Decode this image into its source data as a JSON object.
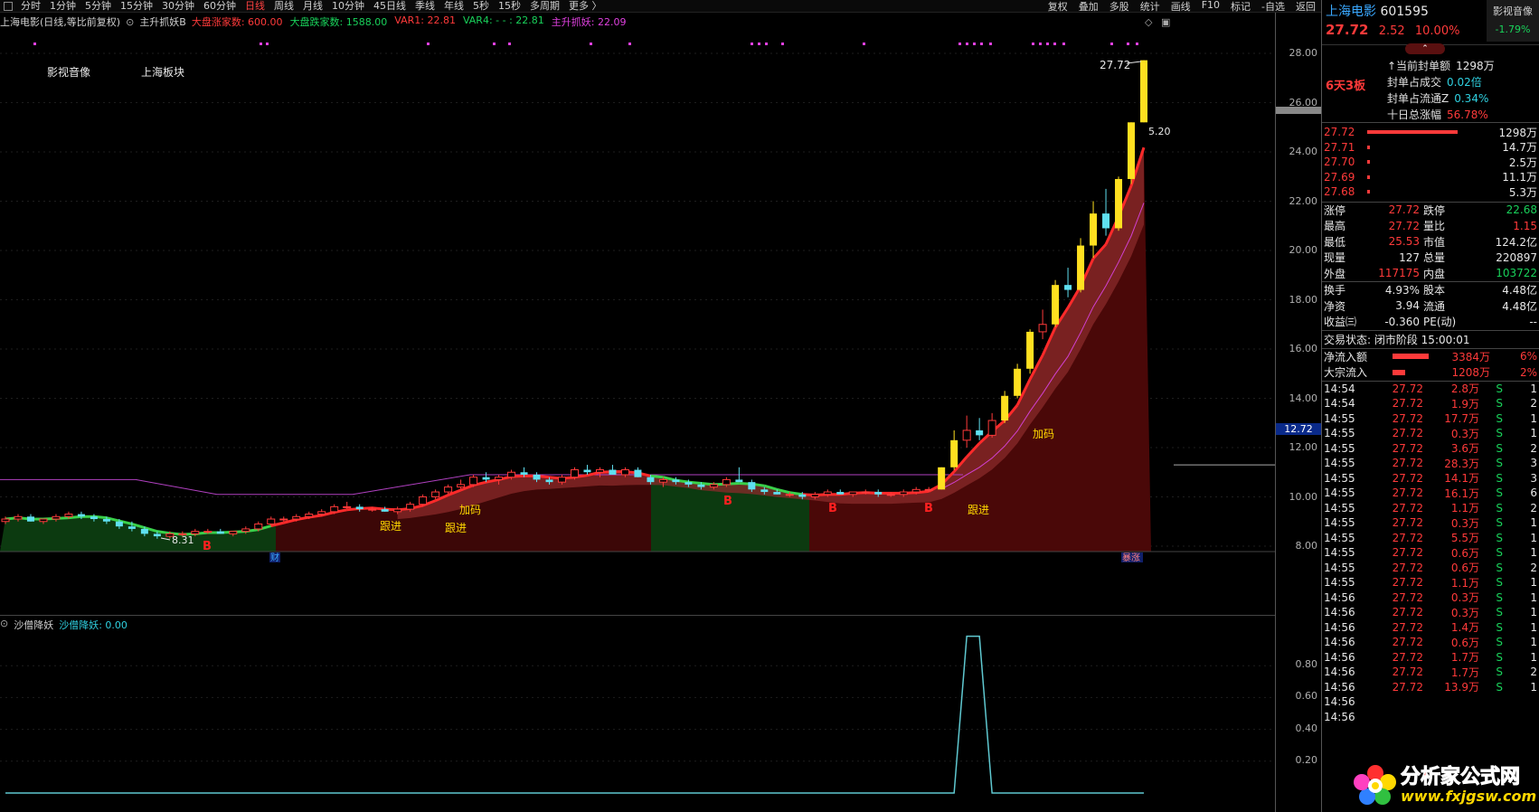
{
  "topbar": {
    "timeframes": [
      "分时",
      "1分钟",
      "5分钟",
      "15分钟",
      "30分钟",
      "60分钟",
      "日线",
      "周线",
      "月线",
      "10分钟",
      "45日线",
      "季线",
      "年线",
      "5秒",
      "15秒",
      "多周期",
      "更多 〉"
    ],
    "active_index": 6,
    "right_buttons": [
      "复权",
      "叠加",
      "多股",
      "统计",
      "画线",
      "F10",
      "标记",
      "-自选",
      "返回"
    ]
  },
  "infobar": {
    "title": "上海电影(日线,等比前复权)",
    "indicator_name": "主升抓妖B",
    "items": [
      {
        "text": "大盘涨家数: 600.00",
        "color": "#ff3a3a"
      },
      {
        "text": "大盘跌家数: 1588.00",
        "color": "#19d15a"
      },
      {
        "text": "VAR1: 22.81",
        "color": "#ff3a3a"
      },
      {
        "text": "VAR4: - - : 22.81",
        "color": "#19d15a"
      },
      {
        "text": "主升抓妖: 22.09",
        "color": "#e040e0"
      }
    ]
  },
  "chart_labels": {
    "sector1": "影视音像",
    "sector2": "上海板块",
    "high_label": "27.72",
    "low_label": "8.31",
    "side_label": "5.20",
    "price_tag": "12.72",
    "cai_label": "财",
    "rise_label": "暴涨",
    "signals": [
      {
        "text": "B",
        "x": 224,
        "y": 596,
        "color": "#ff2020"
      },
      {
        "text": "跟进",
        "x": 420,
        "y": 574,
        "color": "#ffd800"
      },
      {
        "text": "跟进",
        "x": 492,
        "y": 576,
        "color": "#ffd800"
      },
      {
        "text": "加码",
        "x": 508,
        "y": 556,
        "color": "#ffd800"
      },
      {
        "text": "B",
        "x": 800,
        "y": 546,
        "color": "#ff2020"
      },
      {
        "text": "B",
        "x": 916,
        "y": 554,
        "color": "#ff2020"
      },
      {
        "text": "B",
        "x": 1022,
        "y": 554,
        "color": "#ff2020"
      },
      {
        "text": "跟进",
        "x": 1070,
        "y": 556,
        "color": "#ffd800"
      },
      {
        "text": "加码",
        "x": 1142,
        "y": 472,
        "color": "#ffd800"
      }
    ]
  },
  "price_axis": {
    "ticks": [
      "28.00",
      "26.00",
      "24.00",
      "22.00",
      "20.00",
      "18.00",
      "16.00",
      "14.00",
      "12.00",
      "10.00",
      "8.00"
    ],
    "indicator_ticks": [
      "0.80",
      "0.60",
      "0.40",
      "0.20"
    ]
  },
  "indicator": {
    "name": "沙僧降妖",
    "value_text": "沙僧降妖: 0.00"
  },
  "sidebar": {
    "stock_name": "上海电影",
    "stock_code": "601595",
    "sector_name": "影视音像",
    "sector_change": "-1.79%",
    "price": "27.72",
    "change": "2.52",
    "change_pct": "10.00%",
    "board_label": "6天3板",
    "limit_info": [
      {
        "label": "当前封单额",
        "value": "1298万",
        "value_color": "#e8e8e8",
        "prefix": "↑"
      },
      {
        "label": "封单占成交",
        "value": "0.02倍",
        "value_color": "#2fd0e0"
      },
      {
        "label": "封单占流通Z",
        "value": "0.34%",
        "value_color": "#2fd0e0"
      },
      {
        "label": "十日总涨幅",
        "value": "56.78%",
        "value_color": "#ff3a3a"
      }
    ],
    "order_book": [
      {
        "price": "27.72",
        "bar": 100,
        "vol": "1298万"
      },
      {
        "price": "27.71",
        "bar": 2,
        "vol": "14.7万"
      },
      {
        "price": "27.70",
        "bar": 1,
        "vol": "2.5万"
      },
      {
        "price": "27.69",
        "bar": 2,
        "vol": "11.1万"
      },
      {
        "price": "27.68",
        "bar": 1,
        "vol": "5.3万"
      }
    ],
    "stats": [
      {
        "l1": "涨停",
        "v1": "27.72",
        "c1": "#ff3a3a",
        "l2": "跌停",
        "v2": "22.68",
        "c2": "#19d15a"
      },
      {
        "l1": "最高",
        "v1": "27.72",
        "c1": "#ff3a3a",
        "l2": "量比",
        "v2": "1.15",
        "c2": "#ff3a3a"
      },
      {
        "l1": "最低",
        "v1": "25.53",
        "c1": "#ff3a3a",
        "l2": "市值",
        "v2": "124.2亿",
        "c2": "#e8e8e8"
      },
      {
        "l1": "现量",
        "v1": "127",
        "c1": "#e8e8e8",
        "l2": "总量",
        "v2": "220897",
        "c2": "#e8e8e8"
      },
      {
        "l1": "外盘",
        "v1": "117175",
        "c1": "#ff3a3a",
        "l2": "内盘",
        "v2": "103722",
        "c2": "#19d15a"
      }
    ],
    "stats2": [
      {
        "l1": "换手",
        "v1": "4.93%",
        "l2": "股本",
        "v2": "4.48亿"
      },
      {
        "l1": "净资",
        "v1": "3.94",
        "l2": "流通",
        "v2": "4.48亿"
      },
      {
        "l1": "收益㈢",
        "v1": "-0.360",
        "l2": "PE(动)",
        "v2": "--"
      }
    ],
    "trade_status": "交易状态: 闭市阶段 15:00:01",
    "flows": [
      {
        "label": "净流入额",
        "bar": 40,
        "value": "3384万",
        "pct": "6%"
      },
      {
        "label": "大宗流入",
        "bar": 14,
        "value": "1208万",
        "pct": "2%"
      }
    ],
    "ticks": [
      {
        "t": "14:54",
        "p": "27.72",
        "v": "2.8万",
        "s": "S",
        "n": "1"
      },
      {
        "t": "14:54",
        "p": "27.72",
        "v": "1.9万",
        "s": "S",
        "n": "2"
      },
      {
        "t": "14:55",
        "p": "27.72",
        "v": "17.7万",
        "s": "S",
        "n": "1"
      },
      {
        "t": "14:55",
        "p": "27.72",
        "v": "0.3万",
        "s": "S",
        "n": "1"
      },
      {
        "t": "14:55",
        "p": "27.72",
        "v": "3.6万",
        "s": "S",
        "n": "2"
      },
      {
        "t": "14:55",
        "p": "27.72",
        "v": "28.3万",
        "s": "S",
        "n": "3"
      },
      {
        "t": "14:55",
        "p": "27.72",
        "v": "14.1万",
        "s": "S",
        "n": "3"
      },
      {
        "t": "14:55",
        "p": "27.72",
        "v": "16.1万",
        "s": "S",
        "n": "6"
      },
      {
        "t": "14:55",
        "p": "27.72",
        "v": "1.1万",
        "s": "S",
        "n": "2"
      },
      {
        "t": "14:55",
        "p": "27.72",
        "v": "0.3万",
        "s": "S",
        "n": "1"
      },
      {
        "t": "14:55",
        "p": "27.72",
        "v": "5.5万",
        "s": "S",
        "n": "1"
      },
      {
        "t": "14:55",
        "p": "27.72",
        "v": "0.6万",
        "s": "S",
        "n": "1"
      },
      {
        "t": "14:55",
        "p": "27.72",
        "v": "0.6万",
        "s": "S",
        "n": "2"
      },
      {
        "t": "14:55",
        "p": "27.72",
        "v": "1.1万",
        "s": "S",
        "n": "1"
      },
      {
        "t": "14:56",
        "p": "27.72",
        "v": "0.3万",
        "s": "S",
        "n": "1"
      },
      {
        "t": "14:56",
        "p": "27.72",
        "v": "0.3万",
        "s": "S",
        "n": "1"
      },
      {
        "t": "14:56",
        "p": "27.72",
        "v": "1.4万",
        "s": "S",
        "n": "1"
      },
      {
        "t": "14:56",
        "p": "27.72",
        "v": "0.6万",
        "s": "S",
        "n": "1"
      },
      {
        "t": "14:56",
        "p": "27.72",
        "v": "1.7万",
        "s": "S",
        "n": "1"
      },
      {
        "t": "14:56",
        "p": "27.72",
        "v": "1.7万",
        "s": "S",
        "n": "2"
      },
      {
        "t": "14:56",
        "p": "27.72",
        "v": "13.9万",
        "s": "S",
        "n": "1"
      },
      {
        "t": "14:56",
        "p": "",
        "v": "",
        "s": "",
        "n": ""
      },
      {
        "t": "14:56",
        "p": "",
        "v": "",
        "s": "",
        "n": ""
      }
    ]
  },
  "watermark": {
    "title": "分析家公式网",
    "url": "www.fxjgsw.com"
  },
  "chart_data": {
    "type": "candlestick",
    "ylim": [
      8,
      28
    ],
    "ohlc": [
      [
        9.0,
        9.2,
        8.9,
        9.1
      ],
      [
        9.1,
        9.3,
        9.0,
        9.2
      ],
      [
        9.2,
        9.3,
        9.0,
        9.0
      ],
      [
        9.0,
        9.1,
        8.9,
        9.1
      ],
      [
        9.1,
        9.3,
        9.0,
        9.2
      ],
      [
        9.2,
        9.4,
        9.1,
        9.3
      ],
      [
        9.3,
        9.4,
        9.1,
        9.2
      ],
      [
        9.2,
        9.3,
        9.0,
        9.1
      ],
      [
        9.1,
        9.2,
        8.9,
        9.0
      ],
      [
        9.0,
        9.1,
        8.7,
        8.8
      ],
      [
        8.8,
        9.0,
        8.6,
        8.7
      ],
      [
        8.7,
        8.8,
        8.4,
        8.5
      ],
      [
        8.5,
        8.6,
        8.3,
        8.4
      ],
      [
        8.4,
        8.6,
        8.31,
        8.5
      ],
      [
        8.5,
        8.6,
        8.4,
        8.5
      ],
      [
        8.5,
        8.7,
        8.4,
        8.6
      ],
      [
        8.6,
        8.7,
        8.5,
        8.6
      ],
      [
        8.6,
        8.7,
        8.5,
        8.5
      ],
      [
        8.5,
        8.6,
        8.4,
        8.6
      ],
      [
        8.6,
        8.8,
        8.5,
        8.7
      ],
      [
        8.7,
        9.0,
        8.6,
        8.9
      ],
      [
        8.9,
        9.2,
        8.8,
        9.1
      ],
      [
        9.1,
        9.2,
        9.0,
        9.1
      ],
      [
        9.1,
        9.3,
        9.0,
        9.2
      ],
      [
        9.2,
        9.4,
        9.1,
        9.3
      ],
      [
        9.3,
        9.5,
        9.2,
        9.4
      ],
      [
        9.4,
        9.7,
        9.3,
        9.6
      ],
      [
        9.6,
        9.8,
        9.5,
        9.6
      ],
      [
        9.6,
        9.7,
        9.4,
        9.5
      ],
      [
        9.5,
        9.6,
        9.4,
        9.5
      ],
      [
        9.5,
        9.6,
        9.4,
        9.4
      ],
      [
        9.4,
        9.6,
        9.3,
        9.5
      ],
      [
        9.5,
        9.8,
        9.4,
        9.7
      ],
      [
        9.7,
        10.1,
        9.6,
        10.0
      ],
      [
        10.0,
        10.3,
        9.9,
        10.2
      ],
      [
        10.2,
        10.5,
        10.1,
        10.4
      ],
      [
        10.4,
        10.7,
        10.3,
        10.5
      ],
      [
        10.5,
        10.9,
        10.4,
        10.8
      ],
      [
        10.8,
        11.0,
        10.6,
        10.7
      ],
      [
        10.7,
        10.9,
        10.5,
        10.8
      ],
      [
        10.8,
        11.1,
        10.7,
        11.0
      ],
      [
        11.0,
        11.2,
        10.8,
        10.9
      ],
      [
        10.9,
        11.0,
        10.6,
        10.7
      ],
      [
        10.7,
        10.8,
        10.5,
        10.6
      ],
      [
        10.6,
        10.9,
        10.5,
        10.8
      ],
      [
        10.8,
        11.2,
        10.7,
        11.1
      ],
      [
        11.1,
        11.3,
        10.9,
        11.0
      ],
      [
        11.0,
        11.2,
        10.8,
        11.1
      ],
      [
        11.1,
        11.3,
        10.9,
        10.9
      ],
      [
        10.9,
        11.2,
        10.8,
        11.1
      ],
      [
        11.1,
        11.2,
        10.8,
        10.8
      ],
      [
        10.8,
        10.9,
        10.5,
        10.6
      ],
      [
        10.6,
        10.8,
        10.4,
        10.7
      ],
      [
        10.7,
        10.8,
        10.5,
        10.6
      ],
      [
        10.6,
        10.7,
        10.4,
        10.5
      ],
      [
        10.5,
        10.6,
        10.3,
        10.4
      ],
      [
        10.4,
        10.6,
        10.3,
        10.5
      ],
      [
        10.5,
        10.8,
        10.4,
        10.7
      ],
      [
        10.7,
        11.2,
        10.6,
        10.6
      ],
      [
        10.6,
        10.7,
        10.2,
        10.3
      ],
      [
        10.3,
        10.4,
        10.1,
        10.2
      ],
      [
        10.2,
        10.3,
        10.1,
        10.1
      ],
      [
        10.1,
        10.2,
        10.0,
        10.1
      ],
      [
        10.1,
        10.2,
        9.9,
        10.0
      ],
      [
        10.0,
        10.2,
        9.9,
        10.1
      ],
      [
        10.1,
        10.3,
        10.0,
        10.2
      ],
      [
        10.2,
        10.3,
        10.1,
        10.1
      ],
      [
        10.1,
        10.2,
        10.0,
        10.2
      ],
      [
        10.2,
        10.3,
        10.1,
        10.2
      ],
      [
        10.2,
        10.3,
        10.0,
        10.1
      ],
      [
        10.1,
        10.2,
        10.0,
        10.1
      ],
      [
        10.1,
        10.3,
        10.0,
        10.2
      ],
      [
        10.2,
        10.4,
        10.1,
        10.3
      ],
      [
        10.3,
        10.4,
        10.2,
        10.3
      ],
      [
        10.3,
        11.2,
        10.3,
        11.2
      ],
      [
        11.2,
        12.7,
        11.1,
        12.3
      ],
      [
        12.3,
        13.3,
        12.0,
        12.7
      ],
      [
        12.7,
        13.2,
        12.3,
        12.5
      ],
      [
        12.5,
        13.4,
        12.4,
        13.1
      ],
      [
        13.1,
        14.3,
        13.0,
        14.1
      ],
      [
        14.1,
        15.4,
        14.0,
        15.2
      ],
      [
        15.2,
        16.8,
        15.0,
        16.7
      ],
      [
        16.7,
        17.6,
        16.4,
        17.0
      ],
      [
        17.0,
        18.8,
        16.9,
        18.6
      ],
      [
        18.6,
        19.3,
        18.1,
        18.4
      ],
      [
        18.4,
        20.5,
        18.3,
        20.2
      ],
      [
        20.2,
        22.0,
        19.7,
        21.5
      ],
      [
        21.5,
        22.5,
        20.6,
        20.9
      ],
      [
        20.9,
        23.0,
        20.8,
        22.9
      ],
      [
        22.9,
        25.2,
        22.7,
        25.2
      ],
      [
        25.2,
        27.72,
        25.2,
        27.72
      ]
    ],
    "indicator_values": [
      0,
      0,
      0,
      0,
      0,
      0,
      0,
      0,
      0,
      0,
      0,
      0,
      0,
      0,
      0,
      0,
      0,
      0,
      0,
      0,
      0,
      0,
      0,
      0,
      0,
      0,
      0,
      0,
      0,
      0,
      0,
      0,
      0,
      0,
      0,
      0,
      0,
      0,
      0,
      0,
      0,
      0,
      0,
      0,
      0,
      0,
      0,
      0,
      0,
      0,
      0,
      0,
      0,
      0,
      0,
      0,
      0,
      0,
      0,
      0,
      0,
      0,
      0,
      0,
      0,
      0,
      0,
      0,
      0,
      0,
      0,
      0,
      0,
      0,
      0,
      0,
      1,
      1,
      0,
      0,
      0,
      0,
      0,
      0,
      0,
      0,
      0,
      0,
      0,
      0,
      0
    ],
    "indicator_ylim": [
      0,
      1
    ]
  }
}
